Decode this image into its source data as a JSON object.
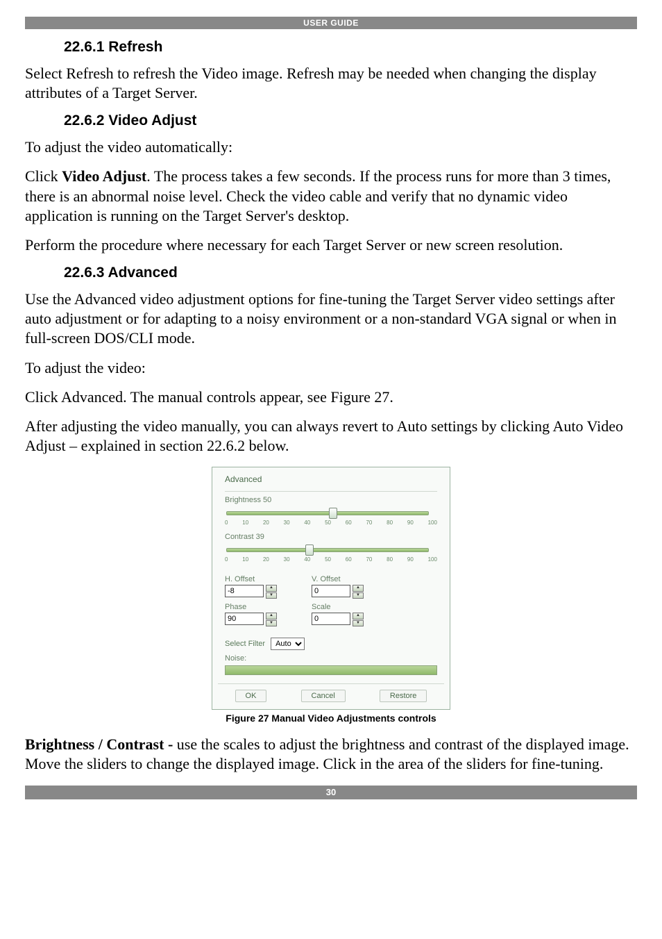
{
  "header": {
    "title": "USER GUIDE"
  },
  "footer": {
    "page_number": "30"
  },
  "sections": {
    "s1": {
      "heading": "22.6.1 Refresh",
      "p1": "Select Refresh to refresh the Video image. Refresh may be needed when changing the display attributes of a Target Server."
    },
    "s2": {
      "heading": "22.6.2 Video Adjust",
      "p1": "To adjust the video automatically:",
      "p2a": "Click ",
      "p2b": "Video Adjust",
      "p2c": ". The process takes a few seconds. If the process runs for more than 3 times, there is an abnormal noise level. Check the video cable and verify that no dynamic video application is running on the Target Server's desktop.",
      "p3": "Perform the procedure where necessary for each Target Server or new screen resolution."
    },
    "s3": {
      "heading": "22.6.3 Advanced",
      "p1": "Use the Advanced video adjustment options for fine-tuning the Target Server video settings after auto adjustment or for adapting to a noisy environment or a non-standard VGA signal or when in full-screen DOS/CLI mode.",
      "p2": "To adjust the video:",
      "p3": "Click Advanced. The manual controls appear, see Figure 27.",
      "p4": "After adjusting the video manually, you can always revert to Auto settings by clicking Auto Video Adjust – explained in section 22.6.2 below."
    },
    "figure": {
      "caption": "Figure 27 Manual Video Adjustments controls"
    },
    "bc": {
      "lead": "Brightness / Contrast -",
      "rest": " use the scales to adjust the brightness and contrast of the displayed image. Move the sliders to change the displayed image. Click in the area of the sliders for fine-tuning."
    }
  },
  "dialog": {
    "title": "Advanced",
    "brightness_label": "Brightness 50",
    "contrast_label": "Contrast 39",
    "ticks": [
      "0",
      "10",
      "20",
      "30",
      "40",
      "50",
      "60",
      "70",
      "80",
      "90",
      "100"
    ],
    "h_offset_label": "H. Offset",
    "h_offset_value": "-8",
    "v_offset_label": "V. Offset",
    "v_offset_value": "0",
    "phase_label": "Phase",
    "phase_value": "90",
    "scale_label": "Scale",
    "scale_value": "0",
    "select_filter_label": "Select Filter",
    "select_filter_value": "Auto",
    "noise_label": "Noise:",
    "ok": "OK",
    "cancel": "Cancel",
    "restore": "Restore"
  },
  "chart_data": {
    "type": "table",
    "title": "Advanced video settings",
    "fields": [
      {
        "name": "Brightness",
        "value": 50,
        "min": 0,
        "max": 100
      },
      {
        "name": "Contrast",
        "value": 39,
        "min": 0,
        "max": 100
      },
      {
        "name": "H. Offset",
        "value": -8
      },
      {
        "name": "V. Offset",
        "value": 0
      },
      {
        "name": "Phase",
        "value": 90
      },
      {
        "name": "Scale",
        "value": 0
      },
      {
        "name": "Select Filter",
        "value": "Auto"
      }
    ]
  }
}
